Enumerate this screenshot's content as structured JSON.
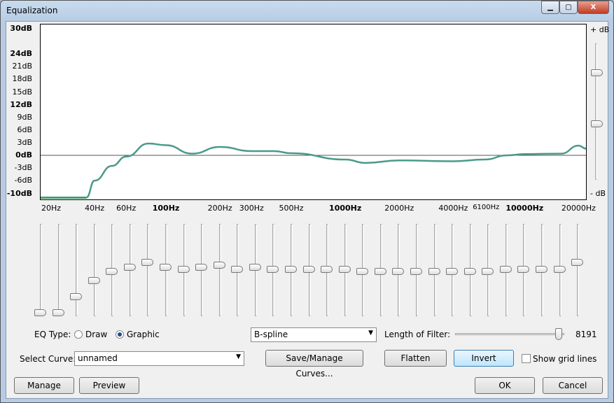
{
  "window": {
    "title": "Equalization",
    "minimize": "▁",
    "maximize": "▢",
    "close": "X"
  },
  "graph": {
    "y_labels": [
      {
        "t": "30dB",
        "db": 30,
        "bold": true
      },
      {
        "t": "24dB",
        "db": 24,
        "bold": true
      },
      {
        "t": "21dB",
        "db": 21
      },
      {
        "t": "18dB",
        "db": 18
      },
      {
        "t": "15dB",
        "db": 15
      },
      {
        "t": "12dB",
        "db": 12,
        "bold": true
      },
      {
        "t": "9dB",
        "db": 9
      },
      {
        "t": "6dB",
        "db": 6
      },
      {
        "t": "3dB",
        "db": 3
      },
      {
        "t": "0dB",
        "db": 0,
        "bold": true
      },
      {
        "t": "-3dB",
        "db": -3
      },
      {
        "t": "-6dB",
        "db": -6
      },
      {
        "t": "-10dB",
        "db": -10,
        "bold": true
      }
    ],
    "x_labels": [
      {
        "t": "20Hz",
        "f": 20
      },
      {
        "t": "40Hz",
        "f": 40
      },
      {
        "t": "60Hz",
        "f": 60
      },
      {
        "t": "100Hz",
        "f": 100,
        "bold": true
      },
      {
        "t": "200Hz",
        "f": 200
      },
      {
        "t": "300Hz",
        "f": 300
      },
      {
        "t": "500Hz",
        "f": 500
      },
      {
        "t": "1000Hz",
        "f": 1000,
        "bold": true
      },
      {
        "t": "2000Hz",
        "f": 2000
      },
      {
        "t": "4000Hz",
        "f": 4000
      },
      {
        "t": "6100Hz",
        "f": 6100
      },
      {
        "t": "10000Hz",
        "f": 10000,
        "bold": true
      },
      {
        "t": "20000Hz",
        "f": 20000
      }
    ],
    "curve": [
      [
        20,
        -10
      ],
      [
        36,
        -10
      ],
      [
        40,
        -6
      ],
      [
        50,
        -2.5
      ],
      [
        60,
        -0.3
      ],
      [
        80,
        2.8
      ],
      [
        100,
        2.4
      ],
      [
        140,
        0.4
      ],
      [
        200,
        2
      ],
      [
        300,
        1
      ],
      [
        400,
        1
      ],
      [
        500,
        0.5
      ],
      [
        1000,
        -1
      ],
      [
        1300,
        -1.8
      ],
      [
        2000,
        -1.2
      ],
      [
        4000,
        -1.4
      ],
      [
        6000,
        -1
      ],
      [
        8000,
        0
      ],
      [
        10000,
        0.3
      ],
      [
        16000,
        0.4
      ],
      [
        20000,
        2.3
      ],
      [
        22000,
        1.6
      ]
    ],
    "curve_color": "#4a9a8a",
    "gain_plus": "+ dB",
    "gain_minus": "- dB"
  },
  "sliders_db": [
    -19,
    -19,
    -12,
    -5,
    -1,
    1,
    3,
    1,
    0,
    1,
    2,
    0,
    1,
    0,
    0,
    0,
    0,
    0,
    -1,
    -1,
    -1,
    -1,
    -1,
    -1,
    -1,
    -1,
    0,
    0,
    0,
    0,
    3
  ],
  "controls": {
    "eq_type_label": "EQ Type:",
    "draw": "Draw",
    "graphic": "Graphic",
    "selected": "Graphic",
    "interp": "B-spline",
    "length_label": "Length of Filter:",
    "length_value": "8191",
    "length_fraction": 0.98,
    "select_curve_label": "Select Curve:",
    "curve": "unnamed",
    "save_manage": "Save/Manage Curves...",
    "flatten": "Flatten",
    "invert": "Invert",
    "grid": "Show grid lines",
    "manage": "Manage",
    "preview": "Preview",
    "ok": "OK",
    "cancel": "Cancel"
  }
}
